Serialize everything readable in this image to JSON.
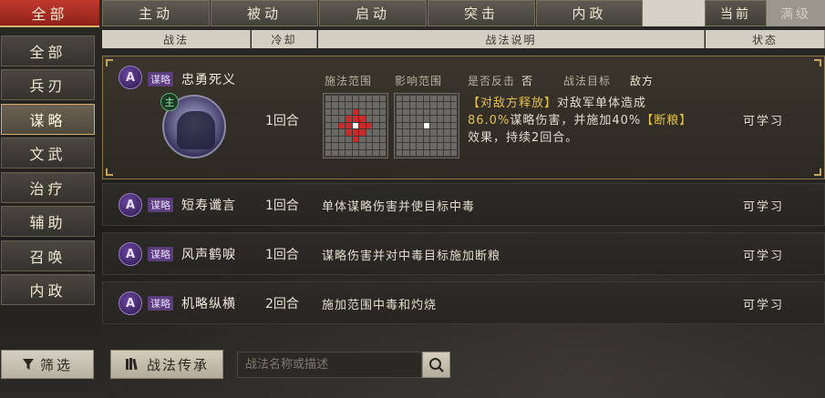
{
  "top_tabs": {
    "all": "全部",
    "items": [
      "主动",
      "被动",
      "启动",
      "突击",
      "内政"
    ],
    "toggle_current": "当前",
    "toggle_max": "满级"
  },
  "sidebar": {
    "items": [
      "全部",
      "兵刃",
      "谋略",
      "文武",
      "治疗",
      "辅助",
      "召唤",
      "内政"
    ],
    "active_index": 2
  },
  "table": {
    "headers": [
      "战法",
      "冷却",
      "战法说明",
      "状态"
    ]
  },
  "expanded": {
    "badge": "A",
    "tag": "谋略",
    "name": "忠勇死义",
    "main_icon": "主",
    "cooldown": "1回合",
    "cast_range_label": "施法范围",
    "effect_range_label": "影响范围",
    "counter_label": "是否反击",
    "counter_value": "否",
    "target_label": "战法目标",
    "target_value": "敌方",
    "desc_line1_hl": "【对敌方释放】",
    "desc_line1": "对敌军单体造成",
    "desc_line2_hl": "86.0%",
    "desc_line2": "谋略伤害，并施加40%",
    "desc_line2_hl2": "【断粮】",
    "desc_line3": "效果，持续2回合。",
    "status": "可学习"
  },
  "rows": [
    {
      "badge": "A",
      "tag": "谋略",
      "name": "短寿谶言",
      "cooldown": "1回合",
      "desc": "单体谋略伤害并使目标中毒",
      "status": "可学习"
    },
    {
      "badge": "A",
      "tag": "谋略",
      "name": "风声鹤唳",
      "cooldown": "1回合",
      "desc": "谋略伤害并对中毒目标施加断粮",
      "status": "可学习"
    },
    {
      "badge": "A",
      "tag": "谋略",
      "name": "机略纵横",
      "cooldown": "2回合",
      "desc": "施加范围中毒和灼烧",
      "status": "可学习"
    }
  ],
  "bottom": {
    "filter_label": "筛选",
    "inherit_label": "战法传承",
    "search_placeholder": "战法名称或描述"
  },
  "icons": {
    "filter": "funnel-icon",
    "inherit": "book-icon",
    "search": "magnifier-icon"
  },
  "colors": {
    "accent_red": "#c0382c",
    "gold": "#d6b06a",
    "purple_tag": "#5a3d7a",
    "highlight_yellow": "#e3c04a"
  }
}
